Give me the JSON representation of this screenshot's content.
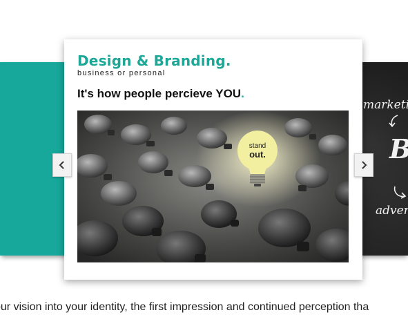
{
  "slider": {
    "left_panel": {
      "color": "#17a89b"
    },
    "right_panel": {
      "lines": [
        "marketing",
        "Bra",
        "advert"
      ]
    },
    "card": {
      "title": "Design & Branding.",
      "subtitle": "business or personal",
      "tagline_main": "It's how people percieve YOU",
      "tagline_dot": ".",
      "image": {
        "description_icon": "lightbulb-image",
        "bulb_text_line1": "stand",
        "bulb_text_line2": "out."
      }
    },
    "prev_icon": "chevron-left-icon",
    "next_icon": "chevron-right-icon"
  },
  "intro": {
    "text": "our vision into your identity, the first impression and continued perception tha"
  },
  "colors": {
    "accent": "#1ea697",
    "teal_panel": "#17a89b",
    "chalkboard": "#1f1f1f",
    "bulb_glow": "#f3efa0"
  }
}
